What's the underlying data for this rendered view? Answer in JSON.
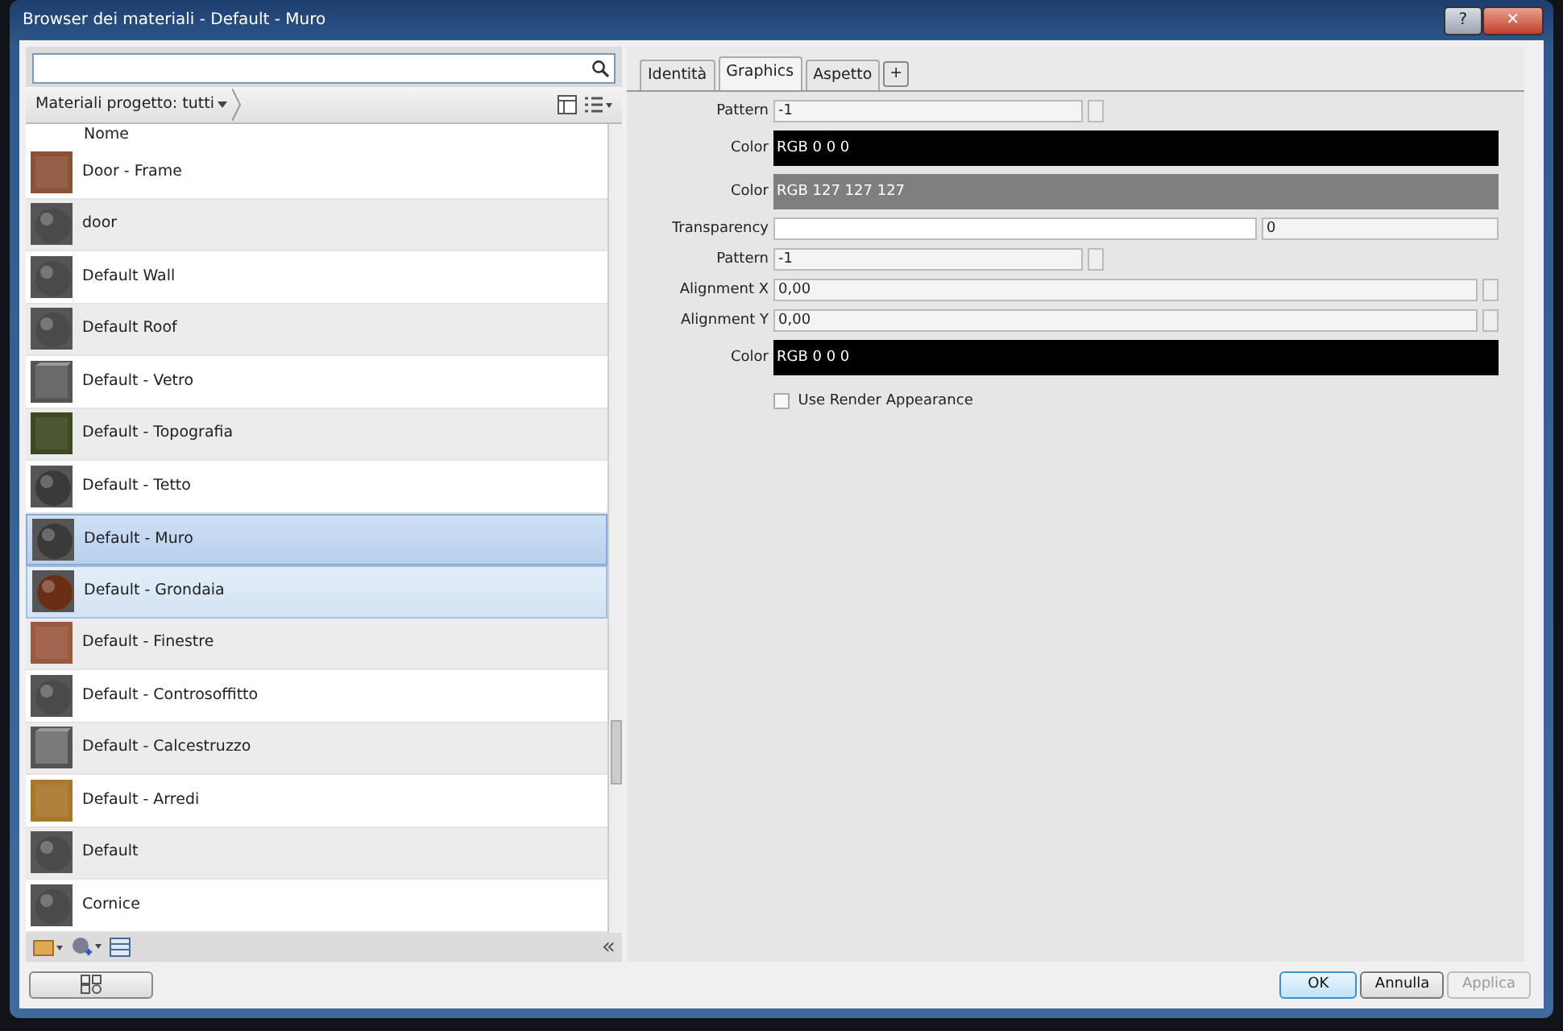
{
  "window": {
    "title": "Browser dei materiali - Default - Muro",
    "buttons": [
      "?",
      "✕"
    ]
  },
  "filter": {
    "label": "Materiali progetto: tutti"
  },
  "list": {
    "column": "Nome",
    "items": [
      {
        "name": "Door - Frame",
        "kind": "flat",
        "color": "#8a5238",
        "selected": false,
        "highlighted": false
      },
      {
        "name": "door",
        "kind": "sphere",
        "color": "#4a4a4a",
        "selected": false,
        "highlighted": false
      },
      {
        "name": "Default Wall",
        "kind": "sphere",
        "color": "#4a4a4a",
        "selected": false,
        "highlighted": false
      },
      {
        "name": "Default Roof",
        "kind": "sphere",
        "color": "#4a4a4a",
        "selected": false,
        "highlighted": false
      },
      {
        "name": "Default - Vetro",
        "kind": "cube",
        "color": "#6a6a6a",
        "selected": false,
        "highlighted": false
      },
      {
        "name": "Default - Topografia",
        "kind": "flat",
        "color": "#3d4a22",
        "selected": false,
        "highlighted": false
      },
      {
        "name": "Default - Tetto",
        "kind": "sphere",
        "color": "#3a3a3a",
        "selected": false,
        "highlighted": false
      },
      {
        "name": "Default - Muro",
        "kind": "sphere",
        "color": "#3a3a3a",
        "selected": true,
        "highlighted": false
      },
      {
        "name": "Default - Grondaia",
        "kind": "sphere",
        "color": "#6a2e14",
        "selected": false,
        "highlighted": true
      },
      {
        "name": "Default - Finestre",
        "kind": "flat",
        "color": "#9a5a40",
        "selected": false,
        "highlighted": false
      },
      {
        "name": "Default - Controsoffitto",
        "kind": "sphere",
        "color": "#4a4a4a",
        "selected": false,
        "highlighted": false
      },
      {
        "name": "Default - Calcestruzzo",
        "kind": "cube",
        "color": "#7a7a7a",
        "selected": false,
        "highlighted": false
      },
      {
        "name": "Default - Arredi",
        "kind": "flat",
        "color": "#a8782c",
        "selected": false,
        "highlighted": false
      },
      {
        "name": "Default",
        "kind": "sphere",
        "color": "#4a4a4a",
        "selected": false,
        "highlighted": false
      },
      {
        "name": "Cornice",
        "kind": "sphere",
        "color": "#4a4a4a",
        "selected": false,
        "highlighted": false
      }
    ]
  },
  "tabs": [
    {
      "label": "Identità",
      "selected": false
    },
    {
      "label": "Graphics",
      "selected": true
    },
    {
      "label": "Aspetto",
      "selected": false
    },
    {
      "label": "+",
      "selected": false
    }
  ],
  "properties": [
    {
      "kind": "spinner",
      "label": "Pattern",
      "value": "-1"
    },
    {
      "kind": "color",
      "label": "Color",
      "value": "RGB 0 0 0",
      "color": "#000000"
    },
    {
      "kind": "color",
      "label": "Color",
      "value": "RGB 127 127 127",
      "color": "#7f7f7f"
    },
    {
      "kind": "slider",
      "label": "Transparency",
      "value": "0"
    },
    {
      "kind": "spinner",
      "label": "Pattern",
      "value": "-1"
    },
    {
      "kind": "wide",
      "label": "Alignment X",
      "value": "0,00"
    },
    {
      "kind": "wide",
      "label": "Alignment Y",
      "value": "0,00"
    },
    {
      "kind": "color",
      "label": "Color",
      "value": "RGB 0 0 0",
      "color": "#000000"
    },
    {
      "kind": "checkbox",
      "label": "Use Render Appearance",
      "checked": false
    }
  ],
  "footer": {
    "collapse": "«",
    "buttons": [
      {
        "label": "OK",
        "kind": "default",
        "disabled": false
      },
      {
        "label": "Annulla",
        "kind": "normal",
        "disabled": false
      },
      {
        "label": "Applica",
        "kind": "normal",
        "disabled": true
      }
    ]
  }
}
